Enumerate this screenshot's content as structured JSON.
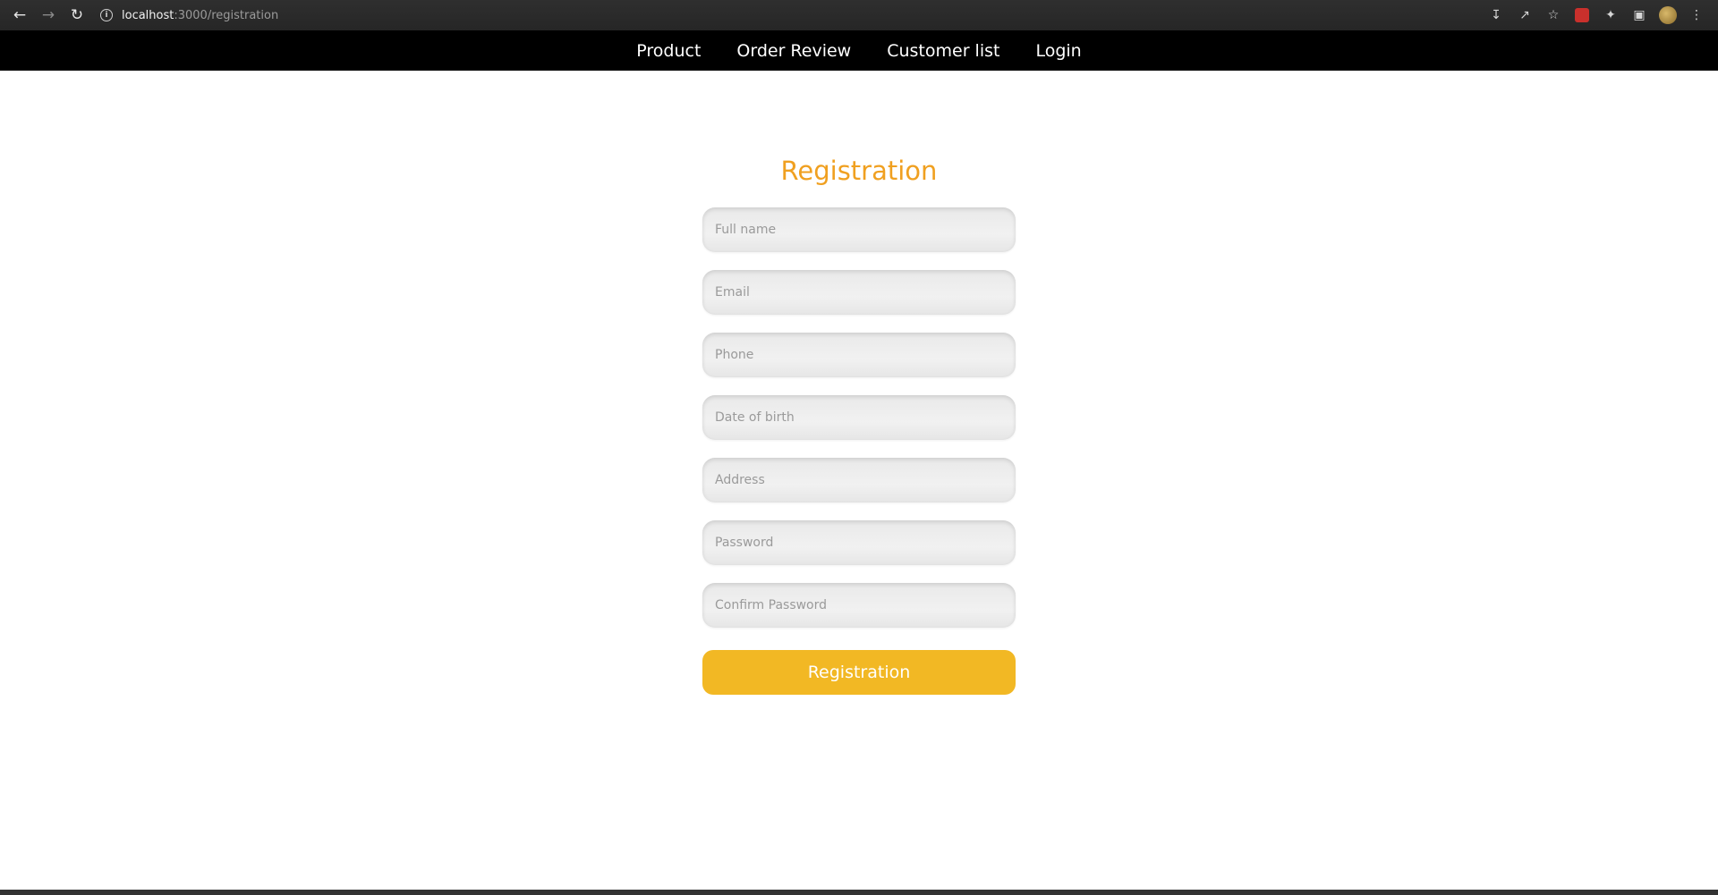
{
  "browser": {
    "url_host": "localhost",
    "url_path": ":3000/registration",
    "back_icon": "arrow-left-icon",
    "forward_icon": "arrow-right-icon",
    "reload_icon": "reload-icon"
  },
  "navbar": {
    "items": [
      {
        "label": "Product"
      },
      {
        "label": "Order Review"
      },
      {
        "label": "Customer list"
      },
      {
        "label": "Login"
      }
    ]
  },
  "form": {
    "title": "Registration",
    "fields": [
      {
        "placeholder": "Full name",
        "value": ""
      },
      {
        "placeholder": "Email",
        "value": ""
      },
      {
        "placeholder": "Phone",
        "value": ""
      },
      {
        "placeholder": "Date of birth",
        "value": ""
      },
      {
        "placeholder": "Address",
        "value": ""
      },
      {
        "placeholder": "Password",
        "value": ""
      },
      {
        "placeholder": "Confirm Password",
        "value": ""
      }
    ],
    "submit_label": "Registration"
  },
  "colors": {
    "title": "#f0a020",
    "button": "#f2b824",
    "navbar_bg": "#000000"
  }
}
